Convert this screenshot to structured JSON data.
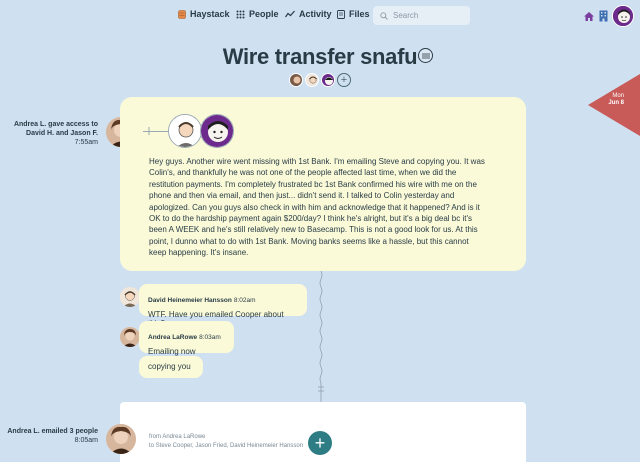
{
  "nav": {
    "items": [
      {
        "label": "Haystack",
        "icon": "haystack-icon"
      },
      {
        "label": "People",
        "icon": "people-icon"
      },
      {
        "label": "Activity",
        "icon": "activity-icon"
      },
      {
        "label": "Files",
        "icon": "files-icon"
      }
    ],
    "search_placeholder": "Search"
  },
  "page": {
    "title": "Wire transfer snafu"
  },
  "date_flag": {
    "weekday": "Mon",
    "date": "Jun 8",
    "color": "#c85a58"
  },
  "access_event": {
    "text": "Andrea L. gave access to David H. and Jason F.",
    "time": "7:55am"
  },
  "message": {
    "body": "Hey guys. Another wire went missing with 1st Bank. I'm emailing Steve and copying you. It was Colin's, and thankfully he was not one of the people affected last time, when we did the restitution payments. I'm completely frustrated bc 1st Bank confirmed his wire with me on the phone and then via email, and then just... didn't send it. I talked to Colin yesterday and apologized. Can you guys also check in with him and acknowledge that it happened? And is it OK to do the hardship payment again $200/day? I think he's alright, but it's a big deal bc it's been A WEEK and he's still relatively new to Basecamp. This is not a good look for us. At this point, I dunno what to do with 1st Bank. Moving banks seems like a hassle, but this cannot keep happening. It's insane."
  },
  "comments": [
    {
      "author": "David Heinemeier Hansson",
      "time": "8:02am",
      "text": "WTF. Have you emailed Cooper about this?"
    },
    {
      "author": "Andrea LaRowe",
      "time": "8:03am",
      "text": "Emailing now"
    },
    {
      "author": "",
      "time": "",
      "text": "copying you"
    }
  ],
  "email_event": {
    "text": "Andrea L. emailed 3 people",
    "time": "8:05am",
    "from": "from Andrea LaRowe",
    "to": "to Steve Cooper, Jason Fried, David Heinemeier Hansson"
  },
  "colors": {
    "background": "#cfe0f1",
    "card": "#fbfad8",
    "accent": "#2f7d84",
    "text": "#283c46"
  }
}
